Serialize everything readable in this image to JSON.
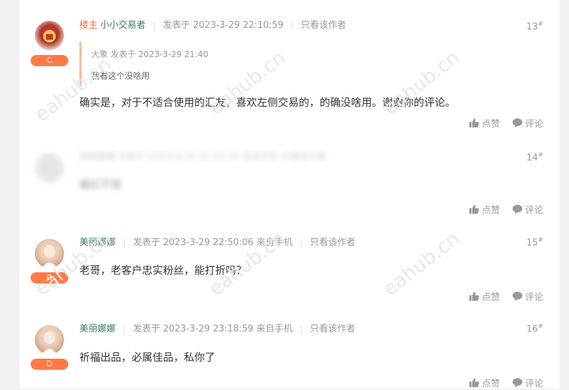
{
  "posts": [
    {
      "badge": "C",
      "op_label": "楼主",
      "author": "小小交易者",
      "posted": "发表于 2023-3-29 22:10:59",
      "only_author": "只看该作者",
      "floor": "13",
      "floor_mark": "#",
      "quote": {
        "meta": "大象 发表于 2023-3-29 21:40",
        "text": "我看这个没啥用"
      },
      "content": "确实是，对于不适合使用的汇友，喜欢左侧交易的，的确没啥用。谢谢你的评论。",
      "like_label": "点赞",
      "comment_label": "评论"
    },
    {
      "floor": "14",
      "floor_mark": "#",
      "blurred_meta": "美丽娜娜  发表于 2023-3-29 22:30:15 来自手机  只看该作者",
      "blurred_content": "确实不错",
      "like_label": "点赞",
      "comment_label": "评论"
    },
    {
      "badge": "D",
      "author": "美丽娜娜",
      "posted": "发表于 2023-3-29 22:50:06 来自手机",
      "only_author": "只看该作者",
      "floor": "15",
      "floor_mark": "#",
      "content": "老哥，老客户忠实粉丝，能打折吗？",
      "like_label": "点赞",
      "comment_label": "评论"
    },
    {
      "badge": "D",
      "author": "美丽娜娜",
      "posted": "发表于 2023-3-29 23:18:59 来自手机",
      "only_author": "只看该作者",
      "floor": "16",
      "floor_mark": "#",
      "content": "祈福出品，必属佳品，私你了",
      "like_label": "点赞",
      "comment_label": "评论"
    }
  ],
  "watermark": "eahub.cn",
  "colors": {
    "accent": "#ff7a45",
    "author": "#3c7a5d",
    "muted": "#999999"
  }
}
